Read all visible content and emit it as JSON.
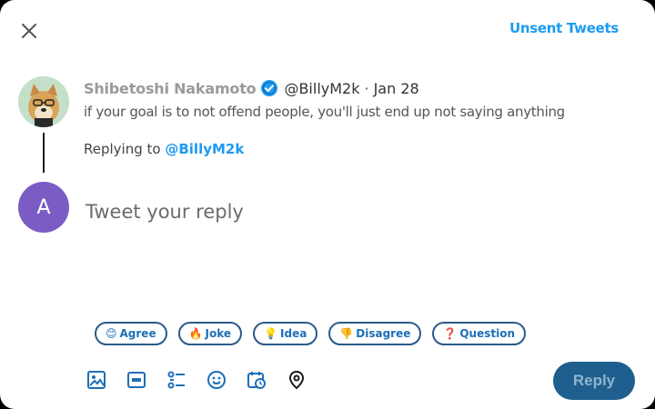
{
  "header": {
    "close_icon": "close-icon",
    "unsent_label": "Unsent Tweets"
  },
  "tweet": {
    "author_name": "Shibetoshi Nakamoto",
    "handle": "@BillyM2k",
    "separator": "·",
    "date": "Jan 28",
    "text": "if your goal is to not offend people, you'll just end up not saying anything",
    "verified_icon": "verified-badge-icon"
  },
  "replying": {
    "prefix": "Replying to",
    "mention": "@BillyM2k"
  },
  "composer": {
    "avatar_letter": "A",
    "placeholder": "Tweet your reply"
  },
  "quick_replies": [
    {
      "emoji": "😊",
      "label": "Agree"
    },
    {
      "emoji": "🔥",
      "label": "Joke"
    },
    {
      "emoji": "💡",
      "label": "Idea"
    },
    {
      "emoji": "👎",
      "label": "Disagree"
    },
    {
      "emoji": "❓",
      "label": "Question"
    }
  ],
  "toolbar": {
    "icons": [
      "image-icon",
      "gif-icon",
      "poll-icon",
      "emoji-icon",
      "schedule-icon",
      "location-icon"
    ],
    "reply_label": "Reply"
  },
  "colors": {
    "accent": "#1d9bf0",
    "reply_button": "#1f5f8f",
    "user_avatar": "#7b5cc4"
  }
}
